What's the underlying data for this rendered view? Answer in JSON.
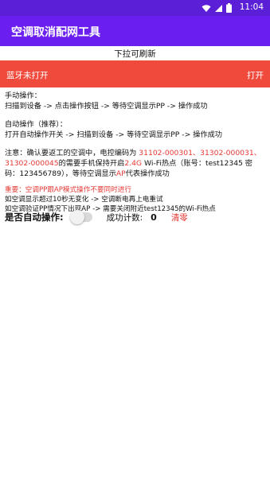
{
  "status_bar": {
    "time": "11:04",
    "icons": [
      "wifi-icon",
      "signal-icon",
      "battery-icon"
    ],
    "bg": "#5a1fd6"
  },
  "app_bar": {
    "title": "空调取消配网工具",
    "bg": "#6a1ff0"
  },
  "pull_hint": "下拉可刷新",
  "banner": {
    "status": "蓝牙未打开",
    "action": "打开",
    "bg": "#f04a3d"
  },
  "instructions": {
    "manual_title": "手动操作：",
    "manual_steps": "扫描到设备 -> 点击操作按钮 -> 等待空调显示PP -> 操作成功",
    "auto_title": "自动操作（推荐）：",
    "auto_steps": "打开自动操作开关 -> 扫描到设备 -> 等待空调显示PP -> 操作成功",
    "note": {
      "part1": "注意：确认要返工的空调中，电控编码为 ",
      "codes": "31102-000301、31302-000031、31302-000045",
      "part2": "的需要手机保持开启",
      "band": "2.4G",
      "part3": " Wi-Fi热点（账号：test12345 密码：123456789），等待空调显示",
      "ap": "AP",
      "part4": "代表操作成功"
    },
    "warning_red": "重要：空调PP跟AP模式操作不要同时进行",
    "warning_1": "如空调显示超过10秒无变化 -> 空调断电再上电重试",
    "warning_2": "如空调验证PP情况下出现AP -> 需要关闭附近test12345的Wi-Fi热点"
  },
  "controls": {
    "auto_label": "是否自动操作:",
    "auto_enabled": false,
    "count_label": "成功计数:",
    "count_value": "0",
    "reset_label": "清零"
  },
  "colors": {
    "accent_red": "#e53935"
  }
}
